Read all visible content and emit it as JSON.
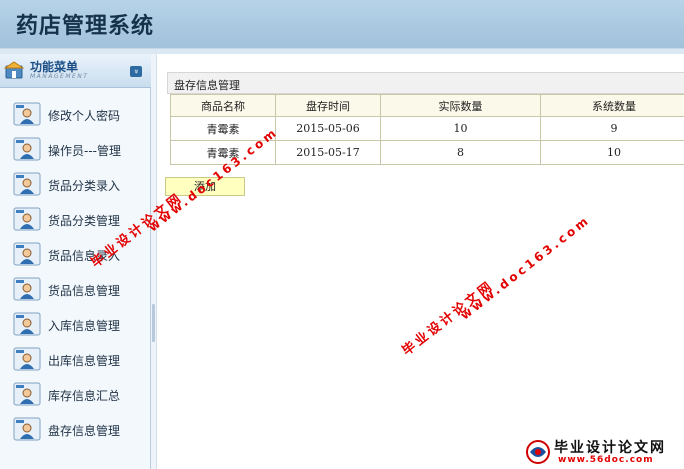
{
  "header": {
    "title": "药店管理系统"
  },
  "sidebar": {
    "title": "功能菜单",
    "subtitle": "MANAGEMENT",
    "collapse_symbol": "»",
    "items": [
      {
        "label": "修改个人密码"
      },
      {
        "label": "操作员---管理"
      },
      {
        "label": "货品分类录入"
      },
      {
        "label": "货品分类管理"
      },
      {
        "label": "货品信息录入"
      },
      {
        "label": "货品信息管理"
      },
      {
        "label": "入库信息管理"
      },
      {
        "label": "出库信息管理"
      },
      {
        "label": "库存信息汇总"
      },
      {
        "label": "盘存信息管理"
      }
    ]
  },
  "main": {
    "panel_title": "盘存信息管理",
    "columns": [
      "商品名称",
      "盘存时间",
      "实际数量",
      "系统数量"
    ],
    "rows": [
      {
        "name": "青霉素",
        "date": "2015-05-06",
        "actual": "10",
        "system": "9"
      },
      {
        "name": "青霉素",
        "date": "2015-05-17",
        "actual": "8",
        "system": "10"
      }
    ],
    "add_label": "添加"
  },
  "watermark": {
    "cn": "毕业设计论文网",
    "url": "www.doc163.com",
    "corner_cn": "毕业设计论文网",
    "corner_url": "www.56doc.com"
  },
  "colors": {
    "header_bg": "#a9c8df",
    "accent": "#1d4f86",
    "watermark": "#e20000",
    "table_header_bg": "#fbf9ea",
    "add_button_bg": "#ffffc0"
  }
}
